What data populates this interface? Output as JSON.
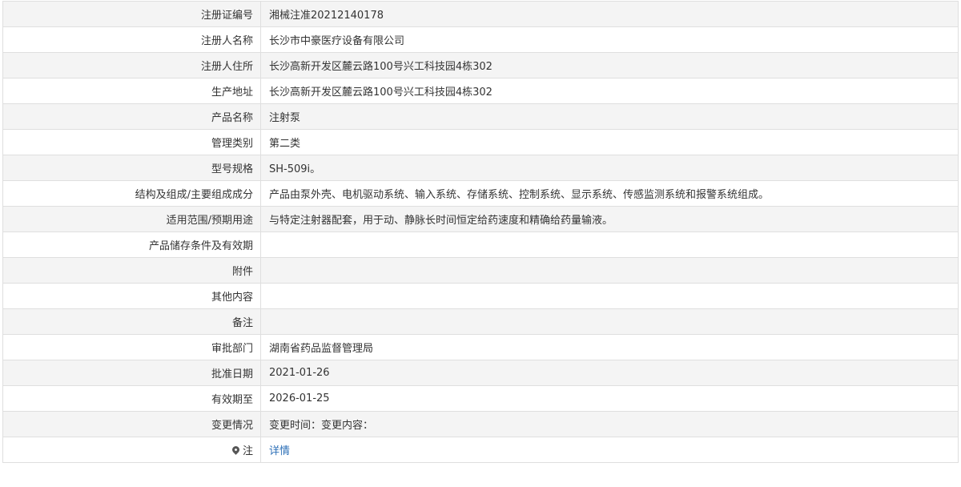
{
  "rows": [
    {
      "label": "注册证编号",
      "value": "湘械注准20212140178"
    },
    {
      "label": "注册人名称",
      "value": "长沙市中豪医疗设备有限公司"
    },
    {
      "label": "注册人住所",
      "value": "长沙高新开发区麓云路100号兴工科技园4栋302"
    },
    {
      "label": "生产地址",
      "value": "长沙高新开发区麓云路100号兴工科技园4栋302"
    },
    {
      "label": "产品名称",
      "value": "注射泵"
    },
    {
      "label": "管理类别",
      "value": "第二类"
    },
    {
      "label": "型号规格",
      "value": "SH-509i。"
    },
    {
      "label": "结构及组成/主要组成成分",
      "value": "产品由泵外壳、电机驱动系统、输入系统、存储系统、控制系统、显示系统、传感监测系统和报警系统组成。"
    },
    {
      "label": "适用范围/预期用途",
      "value": "与特定注射器配套，用于动、静脉长时间恒定给药速度和精确给药量输液。"
    },
    {
      "label": "产品储存条件及有效期",
      "value": ""
    },
    {
      "label": "附件",
      "value": ""
    },
    {
      "label": "其他内容",
      "value": ""
    },
    {
      "label": "备注",
      "value": ""
    },
    {
      "label": "审批部门",
      "value": "湖南省药品监督管理局"
    },
    {
      "label": "批准日期",
      "value": "2021-01-26"
    },
    {
      "label": "有效期至",
      "value": "2026-01-25"
    },
    {
      "label": "变更情况",
      "value": "变更时间：变更内容："
    }
  ],
  "note_row": {
    "icon": "pin-icon",
    "label": "注",
    "link_text": "详情"
  },
  "colors": {
    "row_alt": "#f4f4f4",
    "border": "#dfdfdf",
    "link": "#2c6fb7"
  }
}
